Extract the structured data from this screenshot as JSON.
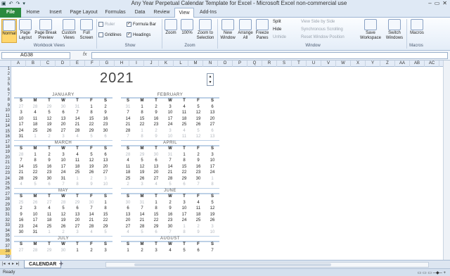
{
  "title_bar": {
    "title": "Any Year Perpetual Calendar Template for Excel  -  Microsoft Excel non-commercial use",
    "qat": [
      "save-icon",
      "undo-icon",
      "redo-icon",
      "dropdown-icon"
    ],
    "controls": [
      "–",
      "▭",
      "✕"
    ]
  },
  "tabs": [
    "File",
    "Home",
    "Insert",
    "Page Layout",
    "Formulas",
    "Data",
    "Review",
    "View",
    "Add-Ins"
  ],
  "ribbon": {
    "workbook_views": {
      "label": "Workbook Views",
      "buttons": [
        "Normal",
        "Page Layout",
        "Page Break Preview",
        "Custom Views",
        "Full Screen"
      ]
    },
    "show": {
      "label": "Show",
      "ruler": "Ruler",
      "formula_bar": "Formula Bar",
      "gridlines": "Gridlines",
      "headings": "Headings"
    },
    "zoom": {
      "label": "Zoom",
      "buttons": [
        "Zoom",
        "100%",
        "Zoom to Selection"
      ]
    },
    "window": {
      "label": "Window",
      "buttons": [
        "New Window",
        "Arrange All",
        "Freeze Panes"
      ],
      "small": [
        "Split",
        "Hide",
        "Unhide",
        "View Side by Side",
        "Synchronous Scrolling",
        "Reset Window Position"
      ],
      "save_workspace": "Save Workspace",
      "switch_windows": "Switch Windows"
    },
    "macros": {
      "label": "Macros",
      "button": "Macros"
    }
  },
  "formula_bar": {
    "name_box": "AG38",
    "fx": "fx",
    "value": ""
  },
  "columns": [
    "A",
    "B",
    "C",
    "D",
    "E",
    "F",
    "G",
    "H",
    "I",
    "J",
    "K",
    "L",
    "M",
    "N",
    "O",
    "P",
    "Q",
    "R",
    "S",
    "T",
    "U",
    "V",
    "W",
    "X",
    "Y",
    "Z",
    "AA",
    "AB",
    "AC"
  ],
  "rows": [
    "1",
    "2",
    "3",
    "5",
    "6",
    "7",
    "8",
    "9",
    "10",
    "11",
    "12",
    "14",
    "15",
    "16",
    "17",
    "18",
    "19",
    "20",
    "21",
    "22",
    "23",
    "24",
    "25",
    "26",
    "27",
    "28",
    "29",
    "30",
    "31",
    "32",
    "33",
    "34",
    "35",
    "36",
    "37",
    "38",
    "39"
  ],
  "selected_row": "38",
  "year": "2021",
  "weekdays": [
    "S",
    "M",
    "T",
    "W",
    "T",
    "F",
    "S"
  ],
  "months": [
    {
      "name": "JANUARY",
      "days": [
        [
          "27",
          "o"
        ],
        [
          "28",
          "o"
        ],
        [
          "29",
          "o"
        ],
        [
          "30",
          "o"
        ],
        [
          "31",
          "o"
        ],
        [
          "1",
          ""
        ],
        [
          "2",
          ""
        ],
        [
          "3",
          ""
        ],
        [
          "4",
          ""
        ],
        [
          "5",
          ""
        ],
        [
          "6",
          ""
        ],
        [
          "7",
          ""
        ],
        [
          "8",
          ""
        ],
        [
          "9",
          ""
        ],
        [
          "10",
          ""
        ],
        [
          "11",
          ""
        ],
        [
          "12",
          ""
        ],
        [
          "13",
          ""
        ],
        [
          "14",
          ""
        ],
        [
          "15",
          ""
        ],
        [
          "16",
          ""
        ],
        [
          "17",
          ""
        ],
        [
          "18",
          ""
        ],
        [
          "19",
          ""
        ],
        [
          "20",
          ""
        ],
        [
          "21",
          ""
        ],
        [
          "22",
          ""
        ],
        [
          "23",
          ""
        ],
        [
          "24",
          ""
        ],
        [
          "25",
          ""
        ],
        [
          "26",
          ""
        ],
        [
          "27",
          ""
        ],
        [
          "28",
          ""
        ],
        [
          "29",
          ""
        ],
        [
          "30",
          ""
        ],
        [
          "31",
          ""
        ],
        [
          "1",
          "o"
        ],
        [
          "2",
          "o"
        ],
        [
          "3",
          "o"
        ],
        [
          "4",
          "o"
        ],
        [
          "5",
          "o"
        ],
        [
          "6",
          "o"
        ]
      ]
    },
    {
      "name": "FEBRUARY",
      "days": [
        [
          "31",
          "o"
        ],
        [
          "1",
          ""
        ],
        [
          "2",
          ""
        ],
        [
          "3",
          ""
        ],
        [
          "4",
          ""
        ],
        [
          "5",
          ""
        ],
        [
          "6",
          ""
        ],
        [
          "7",
          ""
        ],
        [
          "8",
          ""
        ],
        [
          "9",
          ""
        ],
        [
          "10",
          ""
        ],
        [
          "11",
          ""
        ],
        [
          "12",
          ""
        ],
        [
          "13",
          ""
        ],
        [
          "14",
          ""
        ],
        [
          "15",
          ""
        ],
        [
          "16",
          ""
        ],
        [
          "17",
          ""
        ],
        [
          "18",
          ""
        ],
        [
          "19",
          ""
        ],
        [
          "20",
          ""
        ],
        [
          "21",
          ""
        ],
        [
          "22",
          ""
        ],
        [
          "23",
          ""
        ],
        [
          "24",
          ""
        ],
        [
          "25",
          ""
        ],
        [
          "26",
          ""
        ],
        [
          "27",
          ""
        ],
        [
          "28",
          ""
        ],
        [
          "1",
          "o"
        ],
        [
          "2",
          "o"
        ],
        [
          "3",
          "o"
        ],
        [
          "4",
          "o"
        ],
        [
          "5",
          "o"
        ],
        [
          "6",
          "o"
        ],
        [
          "7",
          "o"
        ],
        [
          "8",
          "o"
        ],
        [
          "9",
          "o"
        ],
        [
          "10",
          "o"
        ],
        [
          "11",
          "o"
        ],
        [
          "12",
          "o"
        ],
        [
          "13",
          "o"
        ]
      ]
    },
    {
      "name": "MARCH",
      "days": [
        [
          "28",
          "o"
        ],
        [
          "1",
          ""
        ],
        [
          "2",
          ""
        ],
        [
          "3",
          ""
        ],
        [
          "4",
          ""
        ],
        [
          "5",
          ""
        ],
        [
          "6",
          ""
        ],
        [
          "7",
          ""
        ],
        [
          "8",
          ""
        ],
        [
          "9",
          ""
        ],
        [
          "10",
          ""
        ],
        [
          "11",
          ""
        ],
        [
          "12",
          ""
        ],
        [
          "13",
          ""
        ],
        [
          "14",
          ""
        ],
        [
          "15",
          ""
        ],
        [
          "16",
          ""
        ],
        [
          "17",
          ""
        ],
        [
          "18",
          ""
        ],
        [
          "19",
          ""
        ],
        [
          "20",
          ""
        ],
        [
          "21",
          ""
        ],
        [
          "22",
          ""
        ],
        [
          "23",
          ""
        ],
        [
          "24",
          ""
        ],
        [
          "25",
          ""
        ],
        [
          "26",
          ""
        ],
        [
          "27",
          ""
        ],
        [
          "28",
          ""
        ],
        [
          "29",
          ""
        ],
        [
          "30",
          ""
        ],
        [
          "31",
          ""
        ],
        [
          "1",
          "o"
        ],
        [
          "2",
          "o"
        ],
        [
          "3",
          "o"
        ],
        [
          "4",
          "o"
        ],
        [
          "5",
          "o"
        ],
        [
          "6",
          "o"
        ],
        [
          "7",
          "o"
        ],
        [
          "8",
          "o"
        ],
        [
          "9",
          "o"
        ],
        [
          "10",
          "o"
        ]
      ]
    },
    {
      "name": "APRIL",
      "days": [
        [
          "28",
          "o"
        ],
        [
          "29",
          "o"
        ],
        [
          "30",
          "o"
        ],
        [
          "31",
          "o"
        ],
        [
          "1",
          ""
        ],
        [
          "2",
          ""
        ],
        [
          "3",
          ""
        ],
        [
          "4",
          ""
        ],
        [
          "5",
          ""
        ],
        [
          "6",
          ""
        ],
        [
          "7",
          ""
        ],
        [
          "8",
          ""
        ],
        [
          "9",
          ""
        ],
        [
          "10",
          ""
        ],
        [
          "11",
          ""
        ],
        [
          "12",
          ""
        ],
        [
          "13",
          ""
        ],
        [
          "14",
          ""
        ],
        [
          "15",
          ""
        ],
        [
          "16",
          ""
        ],
        [
          "17",
          ""
        ],
        [
          "18",
          ""
        ],
        [
          "19",
          ""
        ],
        [
          "20",
          ""
        ],
        [
          "21",
          ""
        ],
        [
          "22",
          ""
        ],
        [
          "23",
          ""
        ],
        [
          "24",
          ""
        ],
        [
          "25",
          ""
        ],
        [
          "26",
          ""
        ],
        [
          "27",
          ""
        ],
        [
          "28",
          ""
        ],
        [
          "29",
          ""
        ],
        [
          "30",
          ""
        ],
        [
          "1",
          "o"
        ],
        [
          "2",
          "o"
        ],
        [
          "3",
          "o"
        ],
        [
          "4",
          "o"
        ],
        [
          "5",
          "o"
        ],
        [
          "6",
          "o"
        ],
        [
          "7",
          "o"
        ],
        [
          "8",
          "o"
        ]
      ]
    },
    {
      "name": "MAY",
      "days": [
        [
          "25",
          "o"
        ],
        [
          "26",
          "o"
        ],
        [
          "27",
          "o"
        ],
        [
          "28",
          "o"
        ],
        [
          "29",
          "o"
        ],
        [
          "30",
          "o"
        ],
        [
          "1",
          ""
        ],
        [
          "2",
          ""
        ],
        [
          "3",
          ""
        ],
        [
          "4",
          ""
        ],
        [
          "5",
          ""
        ],
        [
          "6",
          ""
        ],
        [
          "7",
          ""
        ],
        [
          "8",
          ""
        ],
        [
          "9",
          ""
        ],
        [
          "10",
          ""
        ],
        [
          "11",
          ""
        ],
        [
          "12",
          ""
        ],
        [
          "13",
          ""
        ],
        [
          "14",
          ""
        ],
        [
          "15",
          ""
        ],
        [
          "16",
          ""
        ],
        [
          "17",
          ""
        ],
        [
          "18",
          ""
        ],
        [
          "19",
          ""
        ],
        [
          "20",
          ""
        ],
        [
          "21",
          ""
        ],
        [
          "22",
          ""
        ],
        [
          "23",
          ""
        ],
        [
          "24",
          ""
        ],
        [
          "25",
          ""
        ],
        [
          "26",
          ""
        ],
        [
          "27",
          ""
        ],
        [
          "28",
          ""
        ],
        [
          "29",
          ""
        ],
        [
          "30",
          ""
        ],
        [
          "31",
          ""
        ],
        [
          "1",
          "o"
        ],
        [
          "2",
          "o"
        ],
        [
          "3",
          "o"
        ],
        [
          "4",
          "o"
        ],
        [
          "5",
          "o"
        ]
      ]
    },
    {
      "name": "JUNE",
      "days": [
        [
          "30",
          "o"
        ],
        [
          "31",
          "o"
        ],
        [
          "1",
          ""
        ],
        [
          "2",
          ""
        ],
        [
          "3",
          ""
        ],
        [
          "4",
          ""
        ],
        [
          "5",
          ""
        ],
        [
          "6",
          ""
        ],
        [
          "7",
          ""
        ],
        [
          "8",
          ""
        ],
        [
          "9",
          ""
        ],
        [
          "10",
          ""
        ],
        [
          "11",
          ""
        ],
        [
          "12",
          ""
        ],
        [
          "13",
          ""
        ],
        [
          "14",
          ""
        ],
        [
          "15",
          ""
        ],
        [
          "16",
          ""
        ],
        [
          "17",
          ""
        ],
        [
          "18",
          ""
        ],
        [
          "19",
          ""
        ],
        [
          "20",
          ""
        ],
        [
          "21",
          ""
        ],
        [
          "22",
          ""
        ],
        [
          "23",
          ""
        ],
        [
          "24",
          ""
        ],
        [
          "25",
          ""
        ],
        [
          "26",
          ""
        ],
        [
          "27",
          ""
        ],
        [
          "28",
          ""
        ],
        [
          "29",
          ""
        ],
        [
          "30",
          ""
        ],
        [
          "1",
          "o"
        ],
        [
          "2",
          "o"
        ],
        [
          "3",
          "o"
        ],
        [
          "4",
          "o"
        ],
        [
          "5",
          "o"
        ],
        [
          "6",
          "o"
        ],
        [
          "7",
          "o"
        ],
        [
          "8",
          "o"
        ],
        [
          "9",
          "o"
        ],
        [
          "10",
          "o"
        ]
      ]
    },
    {
      "name": "JULY",
      "days": [
        [
          "27",
          "o"
        ],
        [
          "28",
          "o"
        ],
        [
          "29",
          "o"
        ],
        [
          "30",
          "o"
        ],
        [
          "1",
          ""
        ],
        [
          "2",
          ""
        ],
        [
          "3",
          ""
        ]
      ]
    },
    {
      "name": "AUGUST",
      "days": [
        [
          "1",
          ""
        ],
        [
          "2",
          ""
        ],
        [
          "3",
          ""
        ],
        [
          "4",
          ""
        ],
        [
          "5",
          ""
        ],
        [
          "6",
          ""
        ],
        [
          "7",
          ""
        ]
      ]
    }
  ],
  "sheet_tab": "CALENDAR",
  "status": "Ready"
}
